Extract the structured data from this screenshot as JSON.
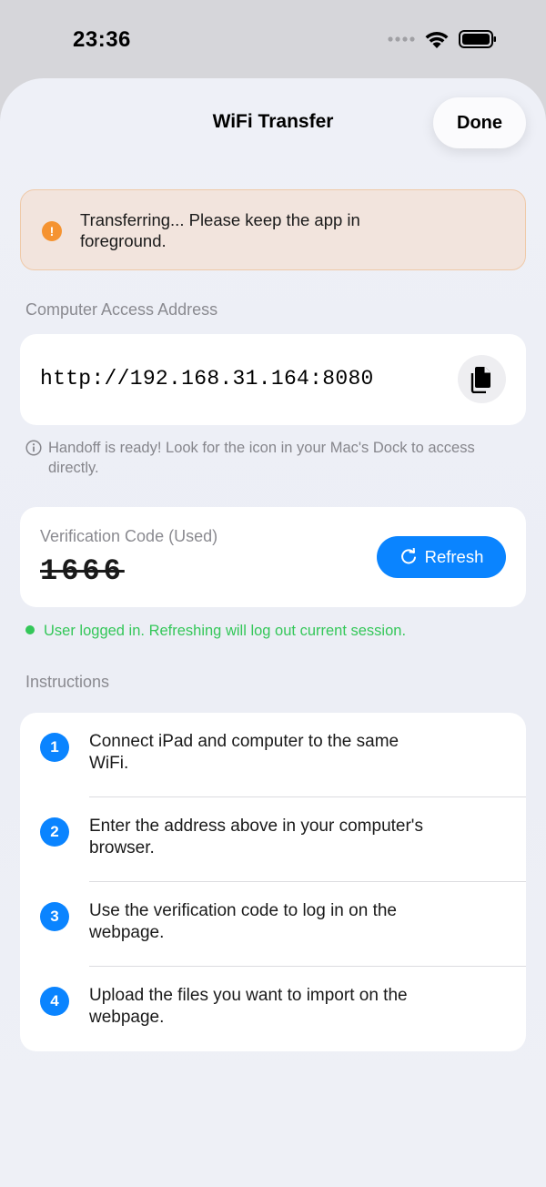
{
  "status_bar": {
    "time": "23:36"
  },
  "nav": {
    "title": "WiFi Transfer",
    "done_label": "Done"
  },
  "alert": {
    "icon": "exclamation-icon",
    "text": "Transferring... Please keep the app in foreground."
  },
  "address_section": {
    "label": "Computer Access Address",
    "address": "http://192.168.31.164:8080",
    "hint": "Handoff is ready! Look for the icon in your Mac's Dock to access directly."
  },
  "verification": {
    "label": "Verification Code (Used)",
    "code": "1666",
    "refresh_label": "Refresh",
    "session_status": "User logged in. Refreshing will log out current session."
  },
  "instructions": {
    "label": "Instructions",
    "steps": [
      {
        "number": "1",
        "text": "Connect iPad and computer to the same WiFi."
      },
      {
        "number": "2",
        "text": "Enter the address above in your computer's browser."
      },
      {
        "number": "3",
        "text": "Use the verification code to log in on the webpage."
      },
      {
        "number": "4",
        "text": "Upload the files you want to import on the webpage."
      }
    ]
  },
  "colors": {
    "accent": "#0a84ff",
    "success": "#34c759",
    "warning": "#f59331"
  }
}
